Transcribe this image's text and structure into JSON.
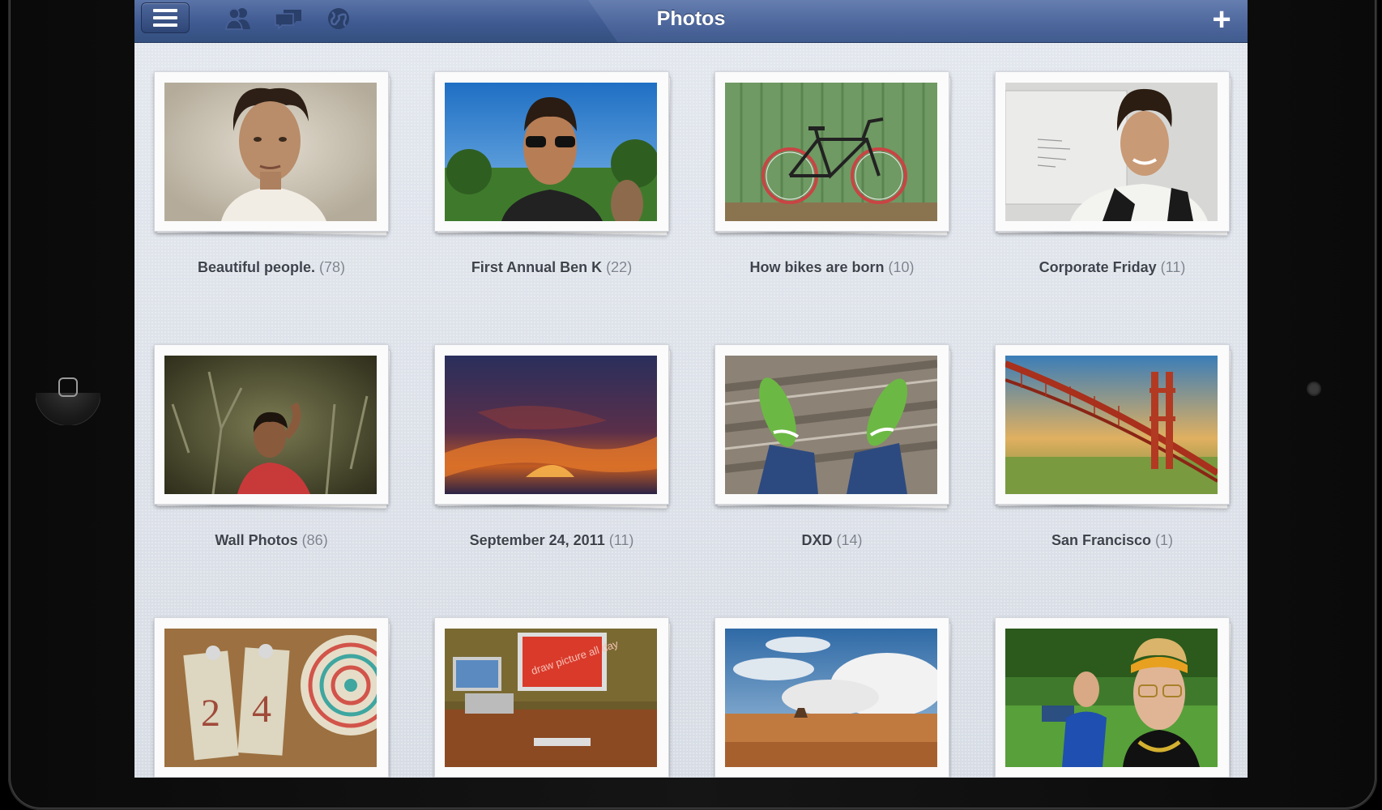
{
  "navbar": {
    "title": "Photos",
    "add_label": "+"
  },
  "albums": [
    {
      "name": "Beautiful people.",
      "count": "(78)"
    },
    {
      "name": "First Annual Ben K",
      "count": "(22)"
    },
    {
      "name": "How bikes are born",
      "count": "(10)"
    },
    {
      "name": "Corporate Friday",
      "count": "(11)"
    },
    {
      "name": "Wall Photos",
      "count": "(86)"
    },
    {
      "name": "September 24, 2011",
      "count": "(11)"
    },
    {
      "name": "DXD",
      "count": "(14)"
    },
    {
      "name": "San Francisco",
      "count": "(1)"
    },
    {
      "name": "",
      "count": ""
    },
    {
      "name": "",
      "count": ""
    },
    {
      "name": "",
      "count": ""
    },
    {
      "name": "",
      "count": ""
    }
  ],
  "photo_art": {
    "text": "draw picture all day"
  },
  "icons": [
    "menu-icon",
    "friends-icon",
    "messages-icon",
    "notifications-globe-icon",
    "add-icon",
    "home-button-icon"
  ],
  "colors": {
    "navbar": "#3f5a91",
    "background": "#dfe3ea",
    "caption": "#4a4f58"
  }
}
